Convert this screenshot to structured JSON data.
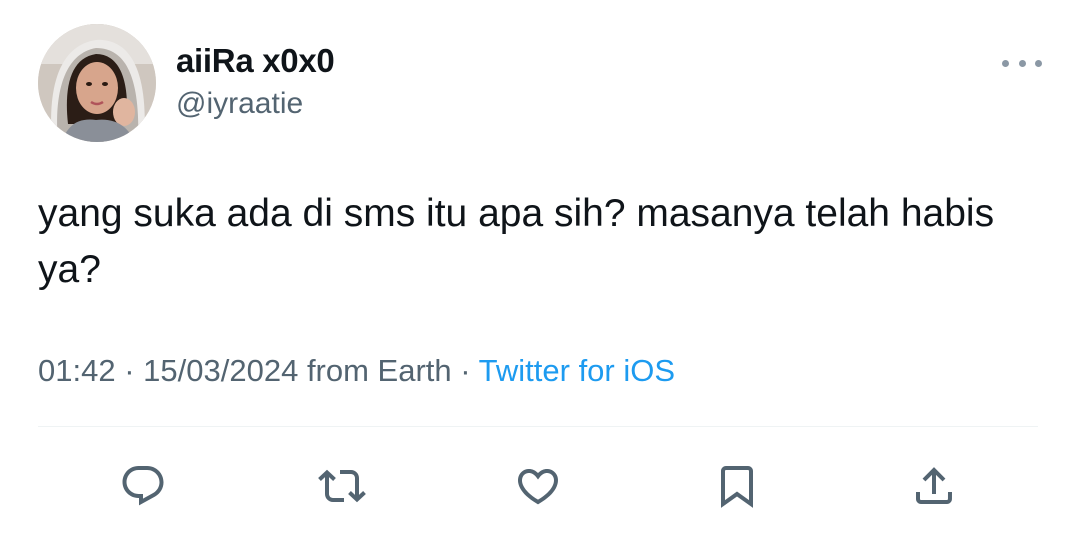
{
  "author": {
    "display_name": "aiiRa x0x0",
    "handle": "@iyraatie"
  },
  "tweet": {
    "text": "yang suka ada di sms itu apa sih? masanya telah habis ya?",
    "time": "01:42",
    "date": "15/03/2024",
    "location": "from Earth",
    "source": "Twitter for iOS",
    "separator": "·"
  },
  "actions": [
    "reply-icon",
    "retweet-icon",
    "like-icon",
    "bookmark-icon",
    "share-icon"
  ],
  "colors": {
    "text": "#0f1419",
    "secondary": "#536471",
    "link": "#1d9bf0",
    "divider": "#eff3f4"
  }
}
